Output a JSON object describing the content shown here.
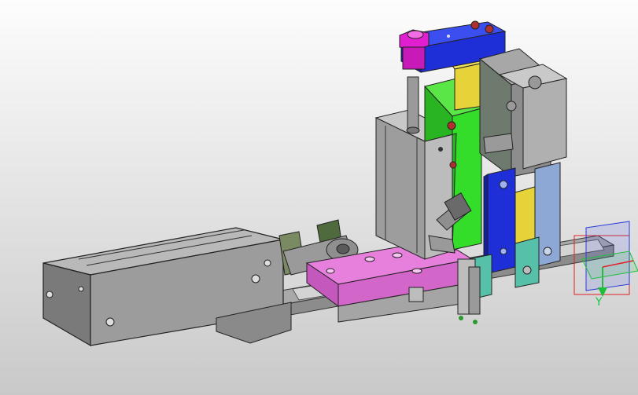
{
  "viewport": {
    "background_top": "#fdfdfd",
    "background_bottom": "#c9c9c9"
  },
  "triad": {
    "y_label": "Y",
    "colors": {
      "x": "#e0202a",
      "y": "#1fbf3a",
      "z": "#2a3ad8"
    }
  },
  "model_colors": {
    "gray_steel": "#9a9a9a",
    "magenta": "#e07ad8",
    "green": "#33dd2a",
    "yellow": "#e6d33a",
    "blue": "#1f2fd8",
    "teal": "#57c0a8",
    "olive": "#4f6a3c",
    "pink_cap": "#e21fd0",
    "light_blue": "#8ea8d6"
  }
}
